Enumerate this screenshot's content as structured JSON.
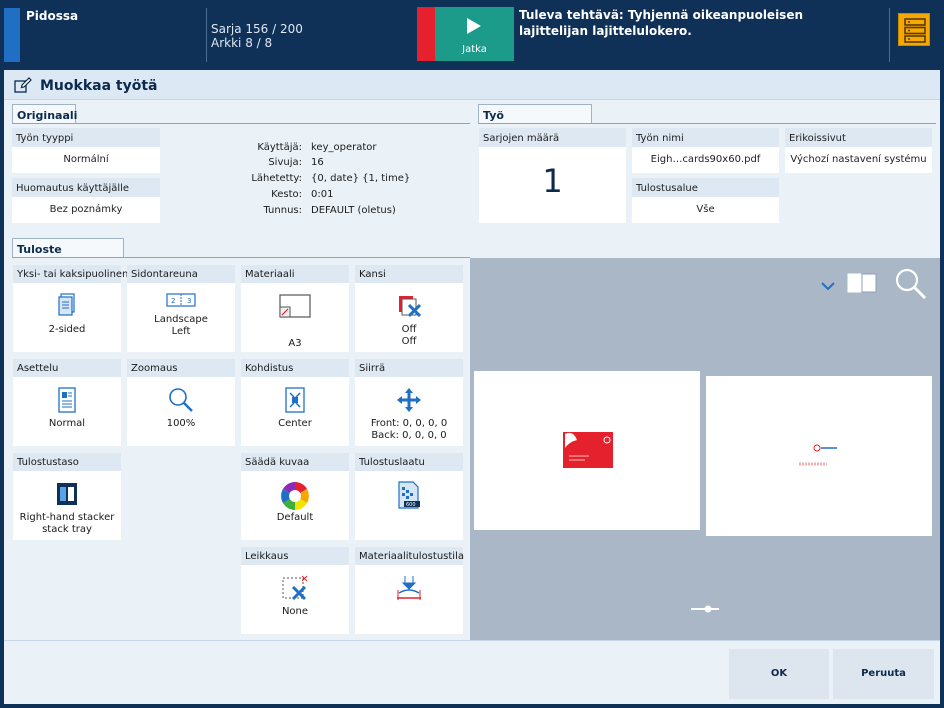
{
  "topbar": {
    "status": "Pidossa",
    "sets": "Sarja 156 / 200",
    "sheets": "Arkki 8 / 8",
    "continue_label": "Jatka",
    "message": "Tuleva tehtävä: Tyhjennä oikeanpuoleisen lajittelijan lajittelulokero."
  },
  "window": {
    "title": "Muokkaa työtä"
  },
  "original": {
    "tab": "Originaali",
    "job_type_label": "Työn tyyppi",
    "job_type_value": "Normální",
    "note_label": "Huomautus käyttäjälle",
    "note_value": "Bez poznámky",
    "info": [
      {
        "key": "Käyttäjä:",
        "value": "key_operator"
      },
      {
        "key": "Sivuja:",
        "value": "16"
      },
      {
        "key": "Lähetetty:",
        "value": "{0, date} {1, time}"
      },
      {
        "key": "Kesto:",
        "value": "0:01"
      },
      {
        "key": "Tunnus:",
        "value": "DEFAULT (oletus)"
      }
    ]
  },
  "job": {
    "tab": "Työ",
    "sets_label": "Sarjojen määrä",
    "sets_value": "1",
    "name_label": "Työn nimi",
    "name_value": "Eigh…cards90x60.pdf",
    "special_label": "Erikoissivut",
    "special_value": "Výchozí nastavení systému",
    "area_label": "Tulostusalue",
    "area_value": "Vše"
  },
  "output": {
    "tab": "Tuloste",
    "tiles": {
      "duplex": {
        "label": "Yksi- tai kaksipuolinen",
        "value": "2-sided"
      },
      "binding": {
        "label": "Sidontareuna",
        "value": "Landscape\nLeft"
      },
      "media": {
        "label": "Materiaali",
        "value": "A3"
      },
      "cover": {
        "label": "Kansi",
        "value": "Off\nOff"
      },
      "layout": {
        "label": "Asettelu",
        "value": "Normal"
      },
      "zoom": {
        "label": "Zoomaus",
        "value": "100%"
      },
      "alignment": {
        "label": "Kohdistus",
        "value": "Center"
      },
      "shift": {
        "label": "Siirrä",
        "value": "Front: 0, 0, 0, 0\nBack: 0, 0, 0, 0"
      },
      "output_location": {
        "label": "Tulostustaso",
        "value": "Right-hand stacker\nstack tray"
      },
      "image_adjust": {
        "label": "Säädä kuvaa",
        "value": "Default"
      },
      "print_quality": {
        "label": "Tulostuslaatu",
        "value": ""
      },
      "trim": {
        "label": "Leikkaus",
        "value": "None"
      },
      "media_print_mode": {
        "label": "Materiaalitulostustila",
        "value": ""
      }
    }
  },
  "buttons": {
    "ok": "OK",
    "cancel": "Peruuta"
  },
  "colors": {
    "topbar": "#0f3057",
    "accent_red": "#e5212d",
    "play": "#1d9b8a",
    "menu": "#f5a800",
    "icon_blue": "#1f6fc5"
  }
}
